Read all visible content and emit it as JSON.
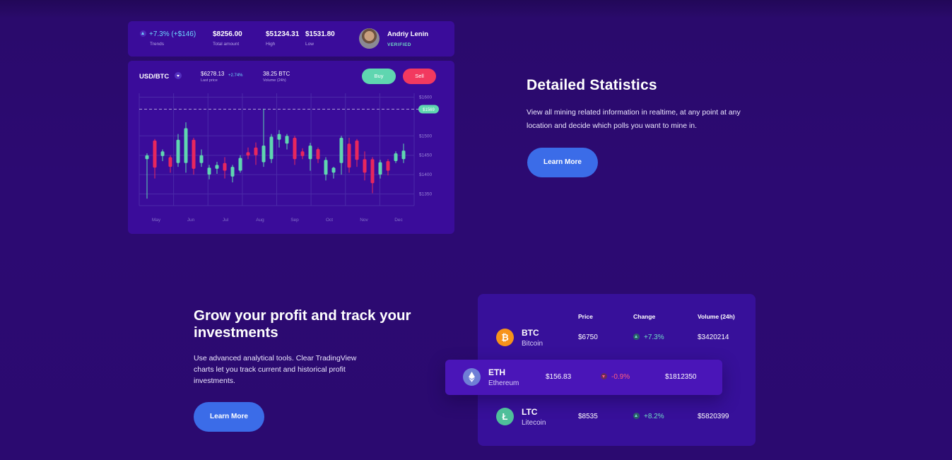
{
  "stats": {
    "trend_value": "+7.3% (+$146)",
    "trend_label": "Trends",
    "total_amount": "$8256.00",
    "total_label": "Total amount",
    "high": "$51234.31",
    "high_label": "High",
    "low": "$1531.80",
    "low_label": "Low",
    "user_name": "Andriy Lenin",
    "user_status": "VERIFIED"
  },
  "trade": {
    "pair": "USD/BTC",
    "last_price": "$6278.13",
    "last_price_change": "+2.74%",
    "last_price_label": "Last price",
    "volume": "38.25 BTC",
    "volume_label": "Volume (24h)",
    "buy_label": "Buy",
    "sell_label": "Sell"
  },
  "chart_data": {
    "type": "candlestick",
    "title": "",
    "x_labels": [
      "May",
      "Jun",
      "Jul",
      "Aug",
      "Sep",
      "Oct",
      "Nov",
      "Dec"
    ],
    "y_ticks": [
      "$1600",
      "$1500",
      "$1450",
      "$1400",
      "$1350"
    ],
    "current_price_label": "$1569",
    "colors": {
      "up": "#5fd6b0",
      "down": "#e8275d",
      "grid": "#4b2aa8"
    },
    "candles": [
      {
        "o": 1440,
        "h": 1455,
        "l": 1338,
        "c": 1450
      },
      {
        "o": 1488,
        "h": 1492,
        "l": 1390,
        "c": 1418
      },
      {
        "o": 1448,
        "h": 1465,
        "l": 1435,
        "c": 1460
      },
      {
        "o": 1445,
        "h": 1450,
        "l": 1405,
        "c": 1420
      },
      {
        "o": 1430,
        "h": 1505,
        "l": 1420,
        "c": 1490
      },
      {
        "o": 1430,
        "h": 1535,
        "l": 1405,
        "c": 1520
      },
      {
        "o": 1490,
        "h": 1495,
        "l": 1400,
        "c": 1415
      },
      {
        "o": 1430,
        "h": 1465,
        "l": 1420,
        "c": 1450
      },
      {
        "o": 1400,
        "h": 1425,
        "l": 1388,
        "c": 1418
      },
      {
        "o": 1415,
        "h": 1433,
        "l": 1402,
        "c": 1425
      },
      {
        "o": 1430,
        "h": 1445,
        "l": 1390,
        "c": 1410
      },
      {
        "o": 1395,
        "h": 1425,
        "l": 1380,
        "c": 1420
      },
      {
        "o": 1410,
        "h": 1450,
        "l": 1405,
        "c": 1443
      },
      {
        "o": 1458,
        "h": 1470,
        "l": 1440,
        "c": 1449
      },
      {
        "o": 1470,
        "h": 1483,
        "l": 1425,
        "c": 1450
      },
      {
        "o": 1432,
        "h": 1570,
        "l": 1420,
        "c": 1475
      },
      {
        "o": 1440,
        "h": 1505,
        "l": 1430,
        "c": 1498
      },
      {
        "o": 1490,
        "h": 1515,
        "l": 1470,
        "c": 1505
      },
      {
        "o": 1480,
        "h": 1505,
        "l": 1465,
        "c": 1500
      },
      {
        "o": 1495,
        "h": 1500,
        "l": 1425,
        "c": 1440
      },
      {
        "o": 1460,
        "h": 1468,
        "l": 1440,
        "c": 1448
      },
      {
        "o": 1440,
        "h": 1482,
        "l": 1410,
        "c": 1475
      },
      {
        "o": 1466,
        "h": 1470,
        "l": 1430,
        "c": 1440
      },
      {
        "o": 1400,
        "h": 1445,
        "l": 1385,
        "c": 1438
      },
      {
        "o": 1405,
        "h": 1420,
        "l": 1390,
        "c": 1418
      },
      {
        "o": 1430,
        "h": 1500,
        "l": 1400,
        "c": 1495
      },
      {
        "o": 1480,
        "h": 1495,
        "l": 1405,
        "c": 1418
      },
      {
        "o": 1488,
        "h": 1492,
        "l": 1420,
        "c": 1438
      },
      {
        "o": 1440,
        "h": 1460,
        "l": 1385,
        "c": 1405
      },
      {
        "o": 1440,
        "h": 1445,
        "l": 1352,
        "c": 1378
      },
      {
        "o": 1400,
        "h": 1438,
        "l": 1390,
        "c": 1432
      },
      {
        "o": 1435,
        "h": 1440,
        "l": 1398,
        "c": 1410
      },
      {
        "o": 1435,
        "h": 1460,
        "l": 1430,
        "c": 1455
      },
      {
        "o": 1440,
        "h": 1480,
        "l": 1430,
        "c": 1462
      }
    ]
  },
  "detail": {
    "title": "Detailed Statistics",
    "text": "View all mining related information in realtime, at any point at any location and decide which polls you want to mine in.",
    "button": "Learn More"
  },
  "grow": {
    "title": "Grow your profit and track your investments",
    "text": "Use advanced analytical tools. Clear TradingView charts let you track current and historical profit investments.",
    "button": "Learn More"
  },
  "table": {
    "headers": {
      "price": "Price",
      "change": "Change",
      "volume": "Volume (24h)"
    },
    "rows": [
      {
        "symbol": "BTC",
        "name": "Bitcoin",
        "price": "$6750",
        "change": "+7.3%",
        "volume": "$3420214",
        "icon": "bitcoin-icon",
        "color": "#f7931a"
      },
      {
        "symbol": "ETH",
        "name": "Ethereum",
        "price": "$156.83",
        "change": "-0.9%",
        "volume": "$1812350",
        "icon": "ethereum-icon",
        "color": "#6f7fd6"
      },
      {
        "symbol": "LTC",
        "name": "Litecoin",
        "price": "$8535",
        "change": "+8.2%",
        "volume": "$5820399",
        "icon": "litecoin-icon",
        "color": "#4fbf9a"
      }
    ]
  }
}
